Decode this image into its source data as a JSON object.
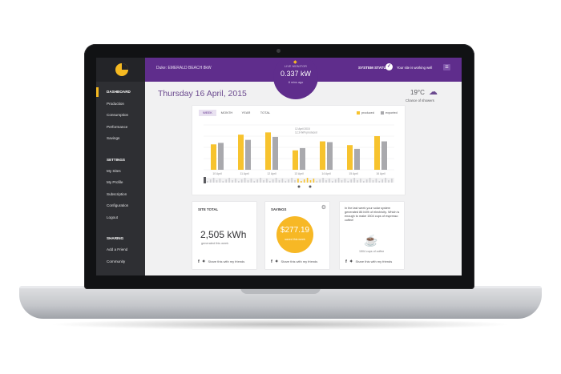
{
  "header": {
    "breadcrumb": "Duke: EMERALD BEACH 8kW",
    "status_label": "SYSTEM STATUS",
    "status_text": "Your site is working well"
  },
  "live_monitor": {
    "label": "LIVE MONITOR",
    "value": "0.337 kW",
    "ago": "8 mins ago"
  },
  "sidebar": {
    "items": [
      {
        "label": "DASHBOARD"
      },
      {
        "label": "Production"
      },
      {
        "label": "Consumption"
      },
      {
        "label": "Performance"
      },
      {
        "label": "Savings"
      }
    ],
    "settings_heading": "SETTINGS",
    "settings_items": [
      {
        "label": "My Sites"
      },
      {
        "label": "My Profile"
      },
      {
        "label": "Subscription"
      },
      {
        "label": "Configuration"
      },
      {
        "label": "Logout"
      }
    ],
    "sharing_heading": "SHARING",
    "sharing_items": [
      {
        "label": "Add a Friend"
      },
      {
        "label": "Community"
      }
    ]
  },
  "main": {
    "date": "Thursday 16 April, 2015",
    "weather": {
      "temp": "19°C",
      "desc": "Chance of showers",
      "icon": "cloud-rain-icon"
    }
  },
  "chart": {
    "tabs": [
      "WEEK",
      "MONTH",
      "YEAR",
      "TOTAL"
    ],
    "legend": [
      "produced",
      "exported"
    ]
  },
  "chart_data": {
    "type": "bar",
    "categories": [
      "10 April",
      "11 April",
      "12 April",
      "13 April",
      "14 April",
      "15 April",
      "16 April"
    ],
    "series": [
      {
        "name": "produced",
        "values": [
          3.4,
          4.7,
          5.0,
          2.6,
          3.8,
          3.3,
          4.5
        ]
      },
      {
        "name": "exported",
        "values": [
          3.6,
          4.0,
          4.4,
          2.9,
          3.7,
          2.8,
          3.8
        ]
      }
    ],
    "ylim": [
      0,
      6
    ],
    "tooltip": "12 April 2015\n12.3 kWh produced",
    "colors": {
      "produced": "#f7c32e",
      "exported": "#a9a9ad"
    }
  },
  "cards": {
    "site_total": {
      "title": "SITE TOTAL",
      "value": "2,505 kWh",
      "sub": "generated this week",
      "share": "Share this with my friends"
    },
    "savings": {
      "title": "SAVINGS",
      "value": "$277.19",
      "sub": "saved this week",
      "share": "Share this with my friends"
    },
    "coffee": {
      "text": "In the last week your solar system generated 86 kWh of electricity. Which is enough to make 1504 cups of espresso coffee!",
      "sub": "1504 cups of coffee",
      "share": "Share this with my friends"
    }
  },
  "colors": {
    "purple": "#5f2d8c",
    "accent": "#f5b921",
    "sidebar": "#2e2f33"
  }
}
